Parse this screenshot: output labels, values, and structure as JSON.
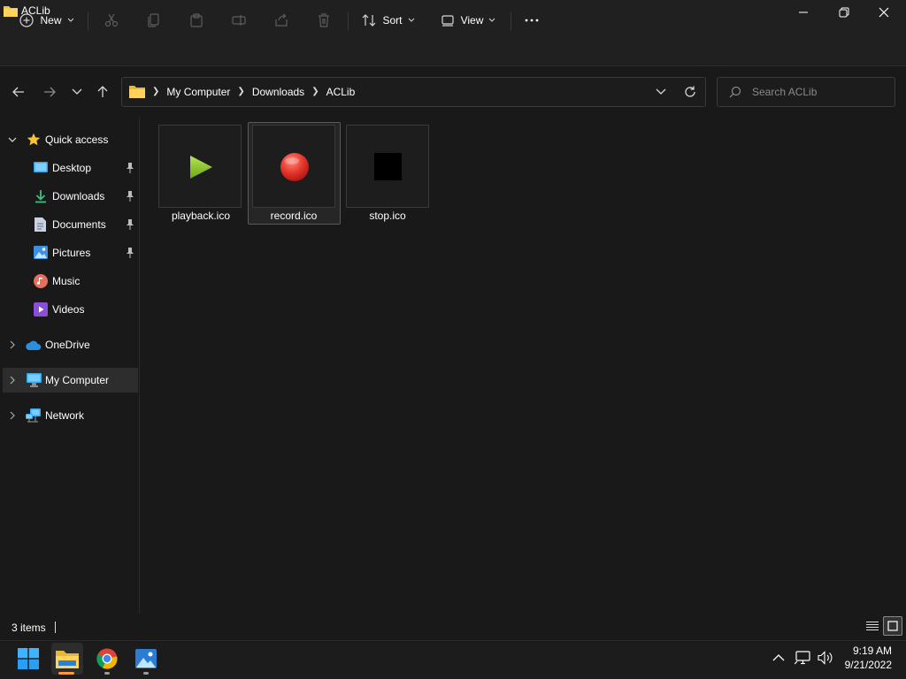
{
  "window": {
    "title": "ACLib"
  },
  "toolbar": {
    "new_label": "New",
    "sort_label": "Sort",
    "view_label": "View"
  },
  "address": {
    "crumbs": [
      "My Computer",
      "Downloads",
      "ACLib"
    ]
  },
  "search": {
    "placeholder": "Search ACLib"
  },
  "sidebar": {
    "items": [
      {
        "label": "Quick access",
        "icon": "star-icon"
      },
      {
        "label": "Desktop",
        "icon": "desktop-icon",
        "pinned": true
      },
      {
        "label": "Downloads",
        "icon": "download-icon",
        "pinned": true
      },
      {
        "label": "Documents",
        "icon": "document-icon",
        "pinned": true
      },
      {
        "label": "Pictures",
        "icon": "pictures-icon",
        "pinned": true
      },
      {
        "label": "Music",
        "icon": "music-icon"
      },
      {
        "label": "Videos",
        "icon": "videos-icon"
      },
      {
        "label": "OneDrive",
        "icon": "onedrive-icon"
      },
      {
        "label": "My Computer",
        "icon": "computer-icon",
        "selected": true
      },
      {
        "label": "Network",
        "icon": "network-icon"
      }
    ]
  },
  "files": [
    {
      "name": "playback.ico",
      "icon": "play-icon",
      "color": "#8bc417"
    },
    {
      "name": "record.ico",
      "icon": "record-icon",
      "color": "#e53a2f",
      "selected": true
    },
    {
      "name": "stop.ico",
      "icon": "stop-icon",
      "color": "#000000"
    }
  ],
  "status": {
    "count": "3 items"
  },
  "taskbar": {
    "time": "9:19 AM",
    "date": "9/21/2022"
  },
  "colors": {
    "accent": "#4cc2ff",
    "folder": "#f4c542"
  }
}
